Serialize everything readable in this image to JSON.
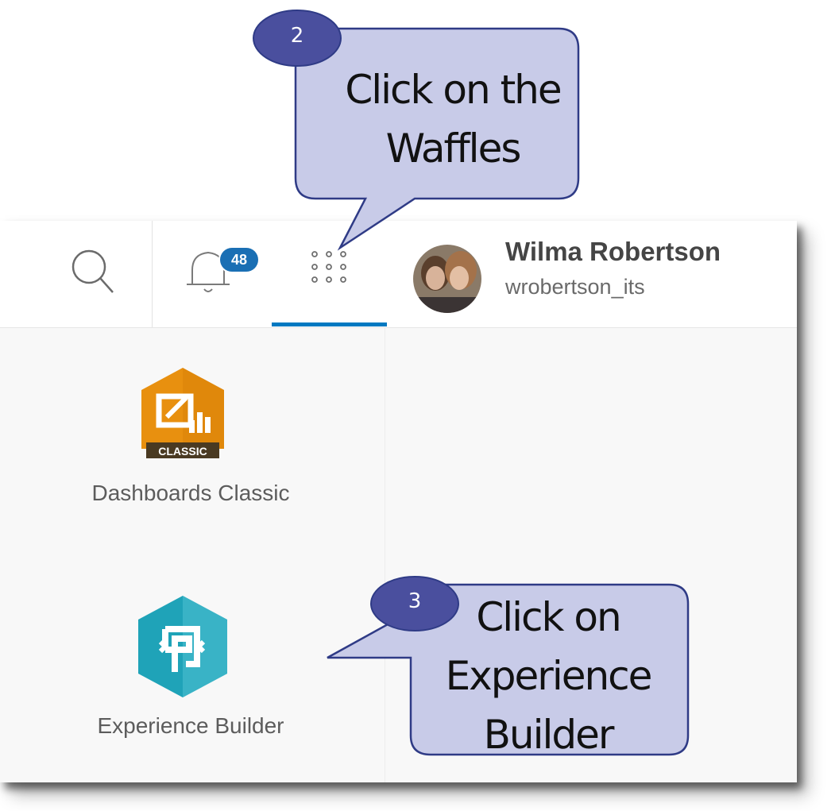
{
  "header": {
    "notification_count": "48",
    "user": {
      "name": "Wilma Robertson",
      "username": "wrobertson_its"
    }
  },
  "apps": [
    {
      "label": "Dashboards Classic",
      "badge_text": "CLASSIC",
      "icon": "dashboards-classic-icon",
      "color": "#e8900f"
    },
    {
      "label": "Experience Builder",
      "icon": "experience-builder-icon",
      "color": "#1fa3b8"
    }
  ],
  "callouts": [
    {
      "step": "2",
      "lines": [
        "Click on the",
        "Waffles"
      ]
    },
    {
      "step": "3",
      "lines": [
        "Click on",
        "Experience",
        "Builder"
      ]
    }
  ],
  "colors": {
    "accent": "#0079c1",
    "callout_fill": "#c8cbe8",
    "callout_stroke": "#2f3b86",
    "step_fill": "#4a4f9e"
  }
}
